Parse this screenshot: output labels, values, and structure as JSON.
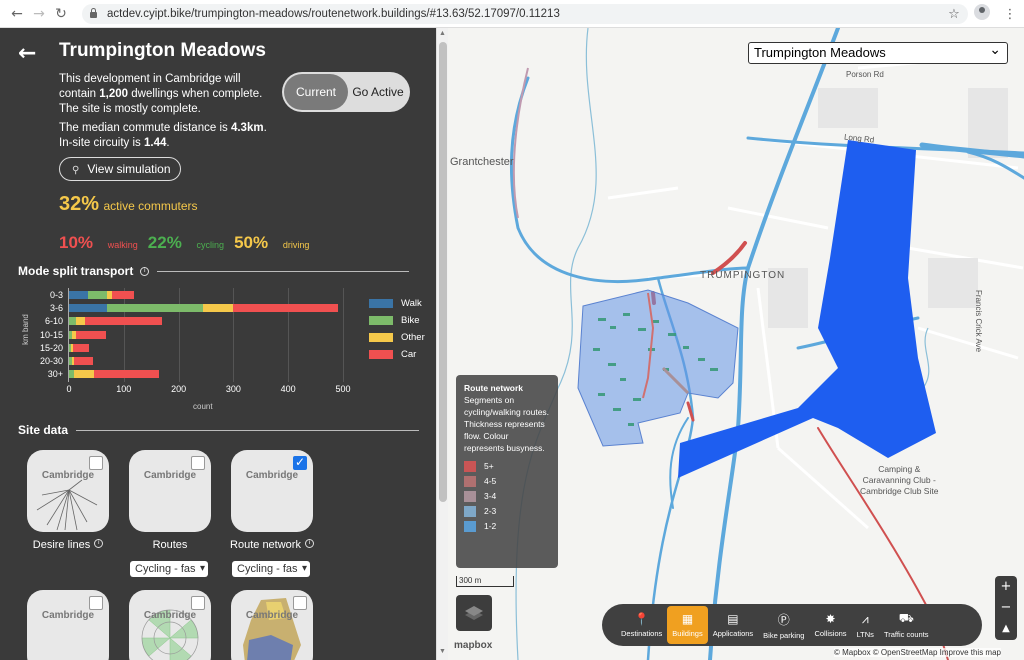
{
  "browser": {
    "url": "actdev.cyipt.bike/trumpington-meadows/routenetwork.buildings/#13.63/52.17097/0.11213"
  },
  "header": {
    "title": "Trumpington Meadows",
    "desc_a": "This development in Cambridge will contain ",
    "desc_dwellings": "1,200",
    "desc_b": " dwellings when complete. The site is mostly complete.",
    "commute_a": "The median commute distance is ",
    "commute_val": "4.3km",
    "commute_b": ".",
    "circuity_a": "In-site circuity is ",
    "circuity_val": "1.44",
    "circuity_b": "."
  },
  "toggle": {
    "current": "Current",
    "go_active": "Go Active"
  },
  "simulation_label": "View simulation",
  "active": {
    "pct": "32%",
    "label": "active commuters"
  },
  "modes": [
    {
      "pct": "10%",
      "label": "walking",
      "color": "#f05050"
    },
    {
      "pct": "22%",
      "label": "cycling",
      "color": "#4caf50"
    },
    {
      "pct": "50%",
      "label": "driving",
      "color": "#f5c84a"
    }
  ],
  "sections": {
    "mode_split": "Mode split transport",
    "site_data": "Site data"
  },
  "chart_data": {
    "type": "bar",
    "orientation": "horizontal",
    "stacked": true,
    "categories": [
      "0-3",
      "3-6",
      "6-10",
      "10-15",
      "15-20",
      "20-30",
      "30+"
    ],
    "series": [
      {
        "name": "Walk",
        "color": "#3a74a6",
        "values": [
          35,
          70,
          0,
          0,
          0,
          0,
          0
        ]
      },
      {
        "name": "Bike",
        "color": "#7dbb6a",
        "values": [
          35,
          175,
          12,
          5,
          4,
          5,
          10
        ]
      },
      {
        "name": "Other",
        "color": "#f5c84a",
        "values": [
          8,
          55,
          18,
          8,
          3,
          4,
          35
        ]
      },
      {
        "name": "Car",
        "color": "#f05050",
        "values": [
          40,
          190,
          140,
          55,
          30,
          35,
          120
        ]
      }
    ],
    "xlim": [
      0,
      500
    ],
    "xticks": [
      0,
      100,
      200,
      300,
      400,
      500
    ],
    "xlabel": "count",
    "ylabel": "km band",
    "legend": "right"
  },
  "cards": [
    {
      "map_label": "Cambridge",
      "label": "Desire lines",
      "checked": false
    },
    {
      "map_label": "Cambridge",
      "label": "Routes",
      "checked": false,
      "select": "Cycling - fas"
    },
    {
      "map_label": "Cambridge",
      "label": "Route network",
      "checked": true,
      "select": "Cycling - fas"
    },
    {
      "map_label": "Cambridge"
    },
    {
      "map_label": "Cambridge"
    },
    {
      "map_label": "Cambridge"
    }
  ],
  "map": {
    "site_select": "Trumpington Meadows",
    "labels": {
      "grantchester": "Grantchester",
      "trumpington": "TRUMPINGTON",
      "porson": "Porson Rd",
      "long": "Long Rd",
      "camping": "Camping &\nCaravanning Club -\nCambridge Club Site",
      "francis": "Francis Crick Ave"
    },
    "route_network": {
      "title": "Route network",
      "text": "Segments on cycling/walking routes. Thickness represents flow. Colour represents busyness.",
      "legend": [
        {
          "label": "5+",
          "color": "#c95555"
        },
        {
          "label": "4-5",
          "color": "#b07070"
        },
        {
          "label": "3-4",
          "color": "#a89098"
        },
        {
          "label": "2-3",
          "color": "#7fa8c8"
        },
        {
          "label": "1-2",
          "color": "#5a9bd0"
        }
      ]
    },
    "scale": "300 m",
    "toolbar": [
      {
        "label": "Destinations",
        "icon": "pin-icon",
        "glyph": "📍"
      },
      {
        "label": "Buildings",
        "icon": "building-icon",
        "glyph": "▦",
        "active": true
      },
      {
        "label": "Applications",
        "icon": "document-icon",
        "glyph": "▤"
      },
      {
        "label": "Bike parking",
        "icon": "parking-icon",
        "glyph": "Ⓟ"
      },
      {
        "label": "Collisions",
        "icon": "collision-icon",
        "glyph": "✸"
      },
      {
        "label": "LTNs",
        "icon": "road-icon",
        "glyph": "⩘"
      },
      {
        "label": "Traffic counts",
        "icon": "car-icon",
        "glyph": "⛟"
      }
    ],
    "mapbox": "mapbox",
    "attribution": "© Mapbox © OpenStreetMap Improve this map"
  }
}
